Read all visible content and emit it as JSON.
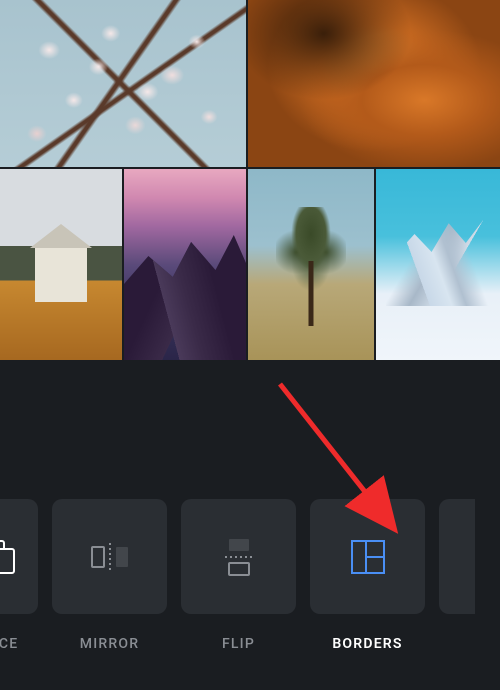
{
  "gallery": {
    "row1": [
      {
        "name": "cherry-blossoms"
      },
      {
        "name": "canyon"
      }
    ],
    "row2": [
      {
        "name": "house-autumn"
      },
      {
        "name": "sunset-mountain"
      },
      {
        "name": "joshua-tree"
      },
      {
        "name": "snowy-peaks"
      }
    ]
  },
  "tools": {
    "items": [
      {
        "id": "replace",
        "label": "LACE",
        "full_label": "REPLACE",
        "selected": false,
        "partial": "left"
      },
      {
        "id": "mirror",
        "label": "MIRROR",
        "selected": false,
        "partial": null
      },
      {
        "id": "flip",
        "label": "FLIP",
        "selected": false,
        "partial": null
      },
      {
        "id": "borders",
        "label": "BORDERS",
        "selected": true,
        "partial": null
      }
    ]
  },
  "colors": {
    "accent": "#4a8ff5",
    "icon_default": "#8a8e94",
    "icon_active_bg": "#ffffff"
  },
  "annotation": {
    "type": "arrow",
    "points_to": "borders-tool"
  }
}
